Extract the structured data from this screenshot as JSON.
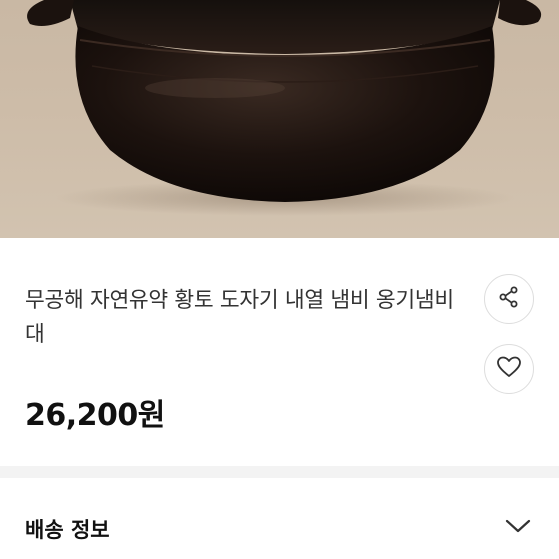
{
  "product": {
    "image_alt": "black clay pot",
    "title": "무공해 자연유약 황토 도자기 내열 냄비 옹기냄비 대",
    "price": "26,200원"
  },
  "actions": {
    "share_icon": "share-icon",
    "like_icon": "heart-icon"
  },
  "shipping": {
    "label": "배송 정보",
    "toggle_icon": "chevron-down-icon"
  }
}
